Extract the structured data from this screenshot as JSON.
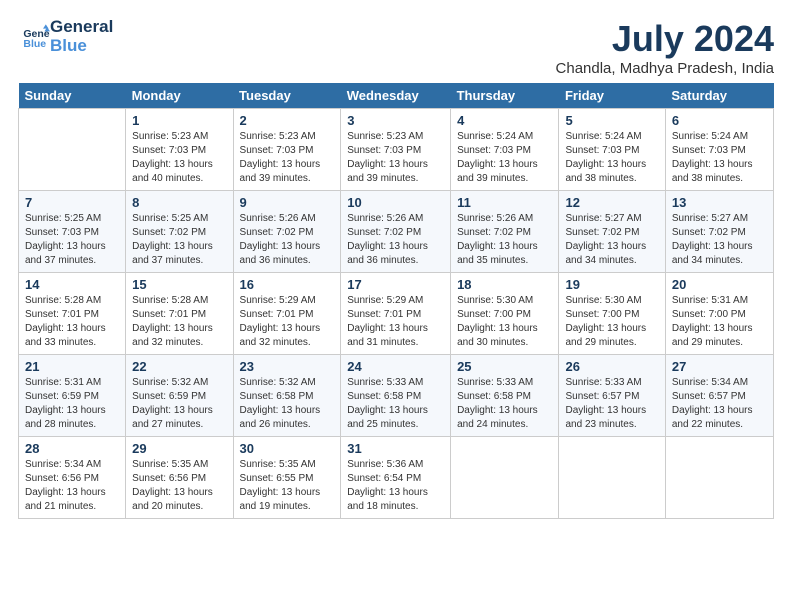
{
  "header": {
    "logo_line1": "General",
    "logo_line2": "Blue",
    "month_title": "July 2024",
    "location": "Chandla, Madhya Pradesh, India"
  },
  "days_of_week": [
    "Sunday",
    "Monday",
    "Tuesday",
    "Wednesday",
    "Thursday",
    "Friday",
    "Saturday"
  ],
  "weeks": [
    [
      {
        "day": "",
        "sunrise": "",
        "sunset": "",
        "daylight": ""
      },
      {
        "day": "1",
        "sunrise": "Sunrise: 5:23 AM",
        "sunset": "Sunset: 7:03 PM",
        "daylight": "Daylight: 13 hours and 40 minutes."
      },
      {
        "day": "2",
        "sunrise": "Sunrise: 5:23 AM",
        "sunset": "Sunset: 7:03 PM",
        "daylight": "Daylight: 13 hours and 39 minutes."
      },
      {
        "day": "3",
        "sunrise": "Sunrise: 5:23 AM",
        "sunset": "Sunset: 7:03 PM",
        "daylight": "Daylight: 13 hours and 39 minutes."
      },
      {
        "day": "4",
        "sunrise": "Sunrise: 5:24 AM",
        "sunset": "Sunset: 7:03 PM",
        "daylight": "Daylight: 13 hours and 39 minutes."
      },
      {
        "day": "5",
        "sunrise": "Sunrise: 5:24 AM",
        "sunset": "Sunset: 7:03 PM",
        "daylight": "Daylight: 13 hours and 38 minutes."
      },
      {
        "day": "6",
        "sunrise": "Sunrise: 5:24 AM",
        "sunset": "Sunset: 7:03 PM",
        "daylight": "Daylight: 13 hours and 38 minutes."
      }
    ],
    [
      {
        "day": "7",
        "sunrise": "Sunrise: 5:25 AM",
        "sunset": "Sunset: 7:03 PM",
        "daylight": "Daylight: 13 hours and 37 minutes."
      },
      {
        "day": "8",
        "sunrise": "Sunrise: 5:25 AM",
        "sunset": "Sunset: 7:02 PM",
        "daylight": "Daylight: 13 hours and 37 minutes."
      },
      {
        "day": "9",
        "sunrise": "Sunrise: 5:26 AM",
        "sunset": "Sunset: 7:02 PM",
        "daylight": "Daylight: 13 hours and 36 minutes."
      },
      {
        "day": "10",
        "sunrise": "Sunrise: 5:26 AM",
        "sunset": "Sunset: 7:02 PM",
        "daylight": "Daylight: 13 hours and 36 minutes."
      },
      {
        "day": "11",
        "sunrise": "Sunrise: 5:26 AM",
        "sunset": "Sunset: 7:02 PM",
        "daylight": "Daylight: 13 hours and 35 minutes."
      },
      {
        "day": "12",
        "sunrise": "Sunrise: 5:27 AM",
        "sunset": "Sunset: 7:02 PM",
        "daylight": "Daylight: 13 hours and 34 minutes."
      },
      {
        "day": "13",
        "sunrise": "Sunrise: 5:27 AM",
        "sunset": "Sunset: 7:02 PM",
        "daylight": "Daylight: 13 hours and 34 minutes."
      }
    ],
    [
      {
        "day": "14",
        "sunrise": "Sunrise: 5:28 AM",
        "sunset": "Sunset: 7:01 PM",
        "daylight": "Daylight: 13 hours and 33 minutes."
      },
      {
        "day": "15",
        "sunrise": "Sunrise: 5:28 AM",
        "sunset": "Sunset: 7:01 PM",
        "daylight": "Daylight: 13 hours and 32 minutes."
      },
      {
        "day": "16",
        "sunrise": "Sunrise: 5:29 AM",
        "sunset": "Sunset: 7:01 PM",
        "daylight": "Daylight: 13 hours and 32 minutes."
      },
      {
        "day": "17",
        "sunrise": "Sunrise: 5:29 AM",
        "sunset": "Sunset: 7:01 PM",
        "daylight": "Daylight: 13 hours and 31 minutes."
      },
      {
        "day": "18",
        "sunrise": "Sunrise: 5:30 AM",
        "sunset": "Sunset: 7:00 PM",
        "daylight": "Daylight: 13 hours and 30 minutes."
      },
      {
        "day": "19",
        "sunrise": "Sunrise: 5:30 AM",
        "sunset": "Sunset: 7:00 PM",
        "daylight": "Daylight: 13 hours and 29 minutes."
      },
      {
        "day": "20",
        "sunrise": "Sunrise: 5:31 AM",
        "sunset": "Sunset: 7:00 PM",
        "daylight": "Daylight: 13 hours and 29 minutes."
      }
    ],
    [
      {
        "day": "21",
        "sunrise": "Sunrise: 5:31 AM",
        "sunset": "Sunset: 6:59 PM",
        "daylight": "Daylight: 13 hours and 28 minutes."
      },
      {
        "day": "22",
        "sunrise": "Sunrise: 5:32 AM",
        "sunset": "Sunset: 6:59 PM",
        "daylight": "Daylight: 13 hours and 27 minutes."
      },
      {
        "day": "23",
        "sunrise": "Sunrise: 5:32 AM",
        "sunset": "Sunset: 6:58 PM",
        "daylight": "Daylight: 13 hours and 26 minutes."
      },
      {
        "day": "24",
        "sunrise": "Sunrise: 5:33 AM",
        "sunset": "Sunset: 6:58 PM",
        "daylight": "Daylight: 13 hours and 25 minutes."
      },
      {
        "day": "25",
        "sunrise": "Sunrise: 5:33 AM",
        "sunset": "Sunset: 6:58 PM",
        "daylight": "Daylight: 13 hours and 24 minutes."
      },
      {
        "day": "26",
        "sunrise": "Sunrise: 5:33 AM",
        "sunset": "Sunset: 6:57 PM",
        "daylight": "Daylight: 13 hours and 23 minutes."
      },
      {
        "day": "27",
        "sunrise": "Sunrise: 5:34 AM",
        "sunset": "Sunset: 6:57 PM",
        "daylight": "Daylight: 13 hours and 22 minutes."
      }
    ],
    [
      {
        "day": "28",
        "sunrise": "Sunrise: 5:34 AM",
        "sunset": "Sunset: 6:56 PM",
        "daylight": "Daylight: 13 hours and 21 minutes."
      },
      {
        "day": "29",
        "sunrise": "Sunrise: 5:35 AM",
        "sunset": "Sunset: 6:56 PM",
        "daylight": "Daylight: 13 hours and 20 minutes."
      },
      {
        "day": "30",
        "sunrise": "Sunrise: 5:35 AM",
        "sunset": "Sunset: 6:55 PM",
        "daylight": "Daylight: 13 hours and 19 minutes."
      },
      {
        "day": "31",
        "sunrise": "Sunrise: 5:36 AM",
        "sunset": "Sunset: 6:54 PM",
        "daylight": "Daylight: 13 hours and 18 minutes."
      },
      {
        "day": "",
        "sunrise": "",
        "sunset": "",
        "daylight": ""
      },
      {
        "day": "",
        "sunrise": "",
        "sunset": "",
        "daylight": ""
      },
      {
        "day": "",
        "sunrise": "",
        "sunset": "",
        "daylight": ""
      }
    ]
  ]
}
